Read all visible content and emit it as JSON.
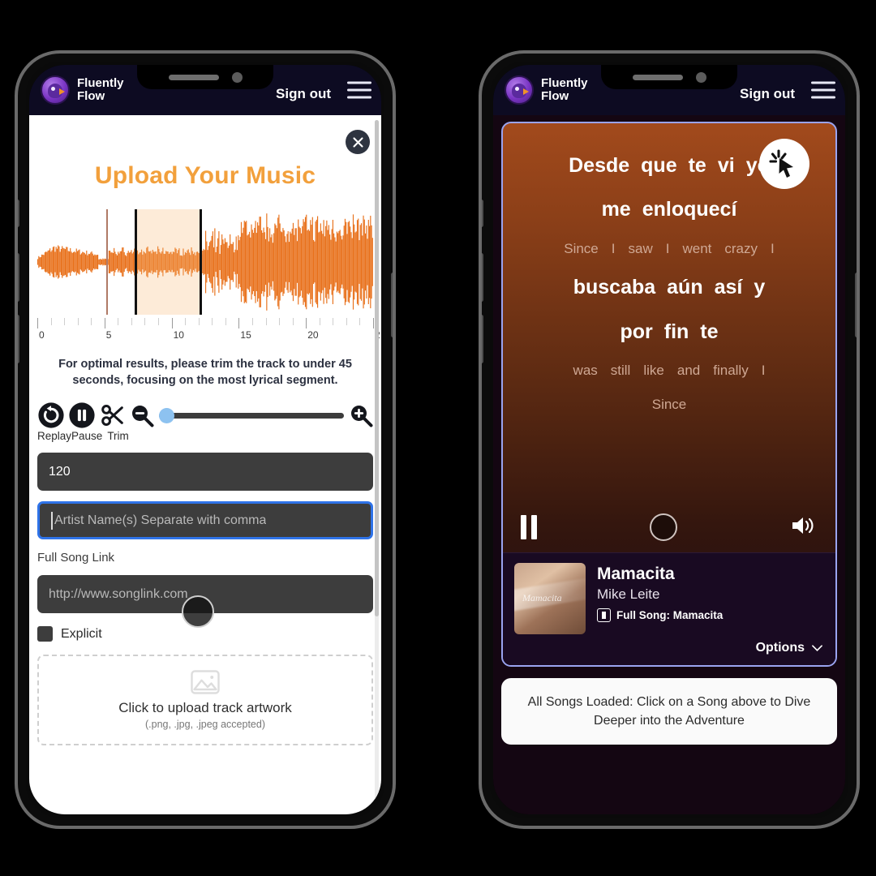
{
  "header": {
    "brand_line1": "Fluently",
    "brand_line2": "Flow",
    "signout_label": "Sign out",
    "logo_icon": "bird-logo-icon",
    "menu_icon": "hamburger-menu-icon"
  },
  "upload_modal": {
    "title": "Upload Your Music",
    "close_icon": "close-x-icon",
    "hint": "For optimal results, please trim the track to under 45 seconds, focusing on the most lyrical segment.",
    "ruler_labels": [
      "0",
      "5",
      "10",
      "15",
      "20",
      "2"
    ],
    "controls": {
      "replay_label": "Replay",
      "pause_label": "Pause",
      "trim_label": "Trim",
      "replay_icon": "replay-icon",
      "pause_icon": "pause-icon",
      "trim_icon": "scissors-icon",
      "zoom_out_icon": "zoom-out-icon",
      "zoom_in_icon": "zoom-in-icon"
    },
    "bpm_value": "120",
    "artist_placeholder": "Artist Name(s) Separate with comma",
    "song_link_label": "Full Song Link",
    "song_link_placeholder": "http://www.songlink.com",
    "explicit_label": "Explicit",
    "dropzone_main": "Click to upload track artwork",
    "dropzone_sub": "(.png, .jpg, .jpeg accepted)",
    "dropzone_icon": "image-placeholder-icon"
  },
  "player": {
    "lyrics": [
      {
        "type": "source",
        "words": [
          "Desde",
          "que",
          "te",
          "vi",
          "yo"
        ]
      },
      {
        "type": "source",
        "words": [
          "me",
          "enloquecí"
        ]
      },
      {
        "type": "translation",
        "words": [
          "Since",
          "I",
          "saw",
          "I",
          "went",
          "crazy",
          "I"
        ]
      },
      {
        "type": "source",
        "words": [
          "buscaba",
          "aún",
          "así",
          "y"
        ]
      },
      {
        "type": "source",
        "words": [
          "por",
          "fin",
          "te"
        ]
      },
      {
        "type": "translation",
        "words": [
          "was",
          "still",
          "like",
          "and",
          "finally",
          "I"
        ]
      },
      {
        "type": "translation",
        "words": [
          "Since"
        ]
      }
    ],
    "controls": {
      "pause_icon": "pause-icon",
      "record_icon": "record-circle-icon",
      "volume_icon": "volume-icon"
    },
    "song": {
      "title": "Mamacita",
      "artist": "Mike Leite",
      "full_song_label": "Full Song: Mamacita",
      "full_song_icon": "music-note-icon",
      "artwork_caption": "Mamacita"
    },
    "options_label": "Options",
    "options_icon": "chevron-down-icon",
    "toast": "All Songs Loaded: Click on a Song above to Dive Deeper into the Adventure"
  },
  "cursors": {
    "left_click_indicator": "click-ring-indicator",
    "right_cursor": "cursor-pointer-badge"
  },
  "colors": {
    "brand_orange": "#f2a03c",
    "header_navy": "#0d0b22",
    "focus_blue": "#2f73e8",
    "waveform_orange": "#e8701a",
    "lyric_card_border": "#9aa4f0"
  }
}
